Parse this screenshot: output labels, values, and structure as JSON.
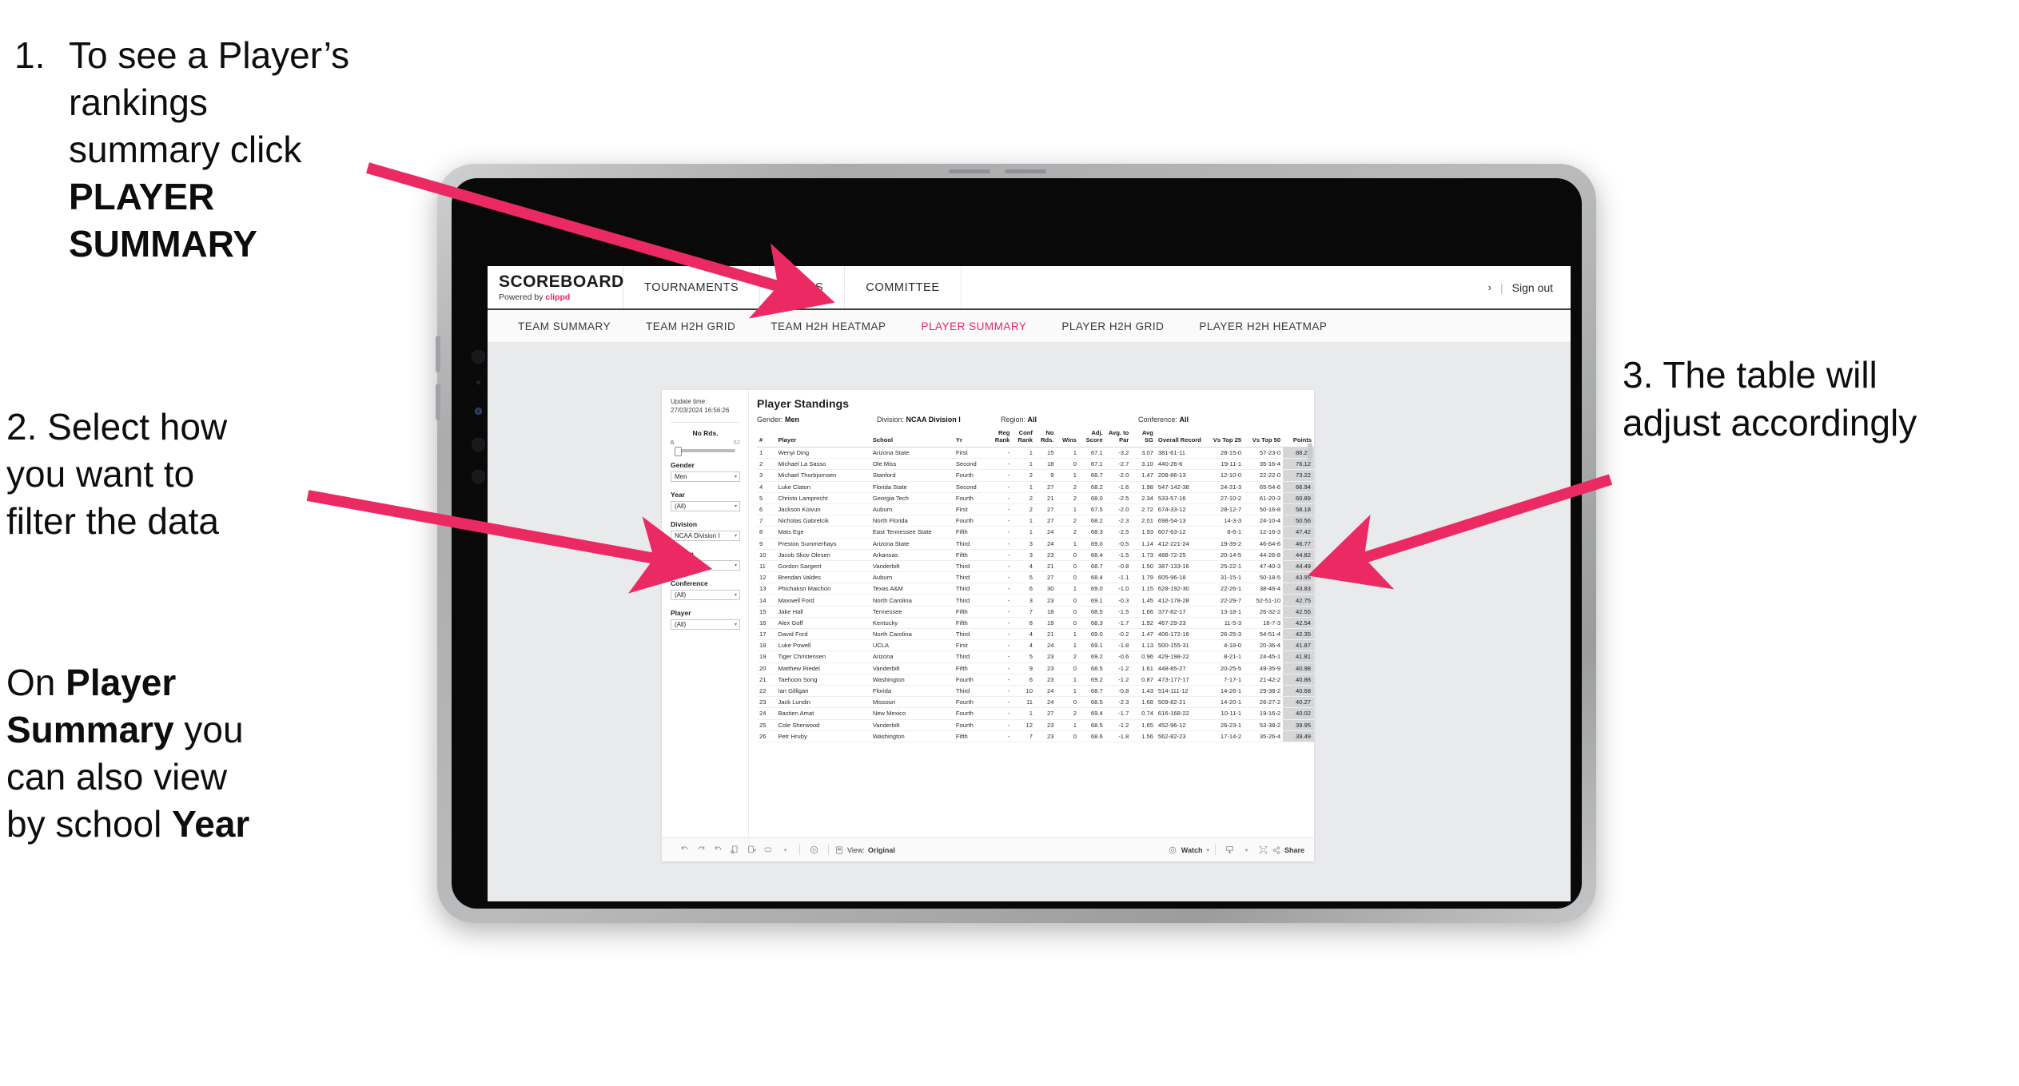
{
  "annotations": {
    "one_number": "1.",
    "one_text_a": "To see a Player’s rankings",
    "one_text_b": "summary click ",
    "one_text_bold": "PLAYER",
    "one_text_c": "SUMMARY",
    "two_line1": "2. Select how",
    "two_line2": "you want to",
    "two_line3": "filter the data",
    "two_b_pre": "On ",
    "two_b_bold1": "Player",
    "two_b_bold2": "Summary",
    "two_b_mid": " you",
    "two_b_line3": "can also view",
    "two_b_line4a": "by school ",
    "two_b_bold3": "Year",
    "three_line1": "3. The table will",
    "three_line2": "adjust accordingly"
  },
  "colors": {
    "accent": "#e8255f",
    "arrow": "#eb2a63",
    "points_highlight": "#d4d6d8"
  },
  "appbar": {
    "brand_title": "SCOREBOARD",
    "brand_sub_pre": "Powered by ",
    "brand_sub_name": "clippd",
    "nav": [
      "TOURNAMENTS",
      "TEAMS",
      "COMMITTEE"
    ],
    "chevron": "›",
    "separator": "|",
    "signout": "Sign out"
  },
  "subnav": {
    "items": [
      {
        "label": "TEAM SUMMARY",
        "active": false
      },
      {
        "label": "TEAM H2H GRID",
        "active": false
      },
      {
        "label": "TEAM H2H HEATMAP",
        "active": false
      },
      {
        "label": "PLAYER SUMMARY",
        "active": true
      },
      {
        "label": "PLAYER H2H GRID",
        "active": false
      },
      {
        "label": "PLAYER H2H HEATMAP",
        "active": false
      }
    ]
  },
  "filters": {
    "update_label": "Update time:",
    "update_value": "27/03/2024 16:56:26",
    "slider": {
      "label": "No Rds.",
      "min": "6",
      "max": "52"
    },
    "fields": [
      {
        "label": "Gender",
        "value": "Men"
      },
      {
        "label": "Year",
        "value": "(All)"
      },
      {
        "label": "Division",
        "value": "NCAA Division I"
      },
      {
        "label": "Region",
        "value": "N/A"
      },
      {
        "label": "Conference",
        "value": "(All)"
      },
      {
        "label": "Player",
        "value": "(All)"
      }
    ],
    "caret": "▾"
  },
  "viz": {
    "title": "Player Standings",
    "summary": [
      {
        "key": "Gender:",
        "val": "Men"
      },
      {
        "key": "Division:",
        "val": "NCAA Division I"
      },
      {
        "key": "Region:",
        "val": "All"
      },
      {
        "key": "Conference:",
        "val": "All"
      }
    ],
    "toolbar": {
      "view_label": "View:",
      "view_value": "Original",
      "watch": "Watch",
      "share": "Share",
      "caret": "▾"
    }
  },
  "chart_data": {
    "type": "table",
    "title": "Player Standings",
    "columns": [
      "#",
      "Player",
      "School",
      "Yr",
      "Reg Rank",
      "Conf Rank",
      "No Rds.",
      "Wins",
      "Adj. Score",
      "Avg. to Par",
      "Avg SG",
      "Overall Record",
      "Vs Top 25",
      "Vs Top 50",
      "Points"
    ],
    "rows": [
      [
        "1",
        "Wenyi Ding",
        "Arizona State",
        "First",
        "-",
        "1",
        "15",
        "1",
        "67.1",
        "-3.2",
        "3.07",
        "381-61-11",
        "28-15-0",
        "57-23-0",
        "88.22"
      ],
      [
        "2",
        "Michael La Sasso",
        "Ole Miss",
        "Second",
        "-",
        "1",
        "18",
        "0",
        "67.1",
        "-2.7",
        "3.10",
        "440-26-6",
        "19-11-1",
        "35-16-4",
        "76.12"
      ],
      [
        "3",
        "Michael Thorbjornsen",
        "Stanford",
        "Fourth",
        "-",
        "2",
        "9",
        "1",
        "68.7",
        "-2.0",
        "1.47",
        "208-86-13",
        "12-10-0",
        "22-22-0",
        "73.22"
      ],
      [
        "4",
        "Luke Claton",
        "Florida State",
        "Second",
        "-",
        "1",
        "27",
        "2",
        "68.2",
        "-1.6",
        "1.98",
        "547-142-38",
        "24-31-3",
        "65-54-6",
        "66.94"
      ],
      [
        "5",
        "Christo Lamprecht",
        "Georgia Tech",
        "Fourth",
        "-",
        "2",
        "21",
        "2",
        "68.0",
        "-2.5",
        "2.34",
        "533-57-16",
        "27-10-2",
        "61-20-3",
        "60.89"
      ],
      [
        "6",
        "Jackson Koivun",
        "Auburn",
        "First",
        "-",
        "2",
        "27",
        "1",
        "67.5",
        "-2.0",
        "2.72",
        "674-33-12",
        "28-12-7",
        "50-16-8",
        "58.18"
      ],
      [
        "7",
        "Nicholas Gabrelcik",
        "North Florida",
        "Fourth",
        "-",
        "1",
        "27",
        "2",
        "68.2",
        "-2.3",
        "2.01",
        "698-54-13",
        "14-3-3",
        "24-10-4",
        "50.56"
      ],
      [
        "8",
        "Mats Ege",
        "East Tennessee State",
        "Fifth",
        "-",
        "1",
        "24",
        "2",
        "68.3",
        "-2.5",
        "1.93",
        "607-63-12",
        "8-6-1",
        "12-16-3",
        "47.42"
      ],
      [
        "9",
        "Preston Summerhays",
        "Arizona State",
        "Third",
        "-",
        "3",
        "24",
        "1",
        "69.0",
        "-0.5",
        "1.14",
        "412-221-24",
        "19-39-2",
        "46-64-6",
        "46.77"
      ],
      [
        "10",
        "Jacob Skov Olesen",
        "Arkansas",
        "Fifth",
        "-",
        "3",
        "23",
        "0",
        "68.4",
        "-1.5",
        "1.73",
        "488-72-25",
        "20-14-5",
        "44-26-8",
        "44.82"
      ],
      [
        "11",
        "Gordon Sargent",
        "Vanderbilt",
        "Third",
        "-",
        "4",
        "21",
        "0",
        "68.7",
        "-0.8",
        "1.50",
        "387-133-16",
        "25-22-1",
        "47-40-3",
        "44.49"
      ],
      [
        "12",
        "Brendan Valdes",
        "Auburn",
        "Third",
        "-",
        "5",
        "27",
        "0",
        "68.4",
        "-1.1",
        "1.79",
        "605-96-18",
        "31-15-1",
        "50-18-5",
        "43.95"
      ],
      [
        "13",
        "Phichaksn Maichon",
        "Texas A&M",
        "Third",
        "-",
        "6",
        "30",
        "1",
        "69.0",
        "-1.0",
        "1.15",
        "628-192-30",
        "22-26-1",
        "38-46-4",
        "43.83"
      ],
      [
        "14",
        "Maxwell Ford",
        "North Carolina",
        "Third",
        "-",
        "3",
        "23",
        "0",
        "69.1",
        "-0.3",
        "1.45",
        "412-178-28",
        "22-29-7",
        "52-51-10",
        "42.75"
      ],
      [
        "15",
        "Jake Hall",
        "Tennessee",
        "Fifth",
        "-",
        "7",
        "18",
        "0",
        "68.5",
        "-1.5",
        "1.66",
        "377-82-17",
        "13-18-1",
        "26-32-2",
        "42.55"
      ],
      [
        "16",
        "Alex Goff",
        "Kentucky",
        "Fifth",
        "-",
        "8",
        "19",
        "0",
        "68.3",
        "-1.7",
        "1.92",
        "467-29-23",
        "11-5-3",
        "18-7-3",
        "42.54"
      ],
      [
        "17",
        "David Ford",
        "North Carolina",
        "Third",
        "-",
        "4",
        "21",
        "1",
        "69.0",
        "-0.2",
        "1.47",
        "406-172-16",
        "26-25-3",
        "54-51-4",
        "42.35"
      ],
      [
        "18",
        "Luke Powell",
        "UCLA",
        "First",
        "-",
        "4",
        "24",
        "1",
        "69.1",
        "-1.8",
        "1.13",
        "500-155-31",
        "4-18-0",
        "20-36-4",
        "41.87"
      ],
      [
        "19",
        "Tiger Christensen",
        "Arizona",
        "Third",
        "-",
        "5",
        "23",
        "2",
        "69.2",
        "-0.6",
        "0.96",
        "429-198-22",
        "8-21-1",
        "24-45-1",
        "41.81"
      ],
      [
        "20",
        "Matthew Riedel",
        "Vanderbilt",
        "Fifth",
        "-",
        "9",
        "23",
        "0",
        "68.5",
        "-1.2",
        "1.61",
        "448-85-27",
        "20-25-5",
        "49-35-9",
        "40.98"
      ],
      [
        "21",
        "Taehoon Song",
        "Washington",
        "Fourth",
        "-",
        "6",
        "23",
        "1",
        "69.2",
        "-1.2",
        "0.87",
        "473-177-17",
        "7-17-1",
        "21-42-2",
        "40.88"
      ],
      [
        "22",
        "Ian Gilligan",
        "Florida",
        "Third",
        "-",
        "10",
        "24",
        "1",
        "68.7",
        "-0.8",
        "1.43",
        "514-111-12",
        "14-26-1",
        "29-38-2",
        "40.68"
      ],
      [
        "23",
        "Jack Lundin",
        "Missouri",
        "Fourth",
        "-",
        "11",
        "24",
        "0",
        "68.5",
        "-2.3",
        "1.68",
        "509-82-21",
        "14-20-1",
        "26-27-2",
        "40.27"
      ],
      [
        "24",
        "Bastien Amat",
        "New Mexico",
        "Fourth",
        "-",
        "1",
        "27",
        "2",
        "69.4",
        "-1.7",
        "0.74",
        "616-168-22",
        "10-11-1",
        "19-16-2",
        "40.02"
      ],
      [
        "25",
        "Cole Sherwood",
        "Vanderbilt",
        "Fourth",
        "-",
        "12",
        "23",
        "1",
        "68.5",
        "-1.2",
        "1.65",
        "452-96-12",
        "26-23-1",
        "53-38-2",
        "39.95"
      ],
      [
        "26",
        "Petr Hruby",
        "Washington",
        "Fifth",
        "-",
        "7",
        "23",
        "0",
        "68.6",
        "-1.8",
        "1.56",
        "562-82-23",
        "17-14-2",
        "35-26-4",
        "39.49"
      ]
    ]
  }
}
